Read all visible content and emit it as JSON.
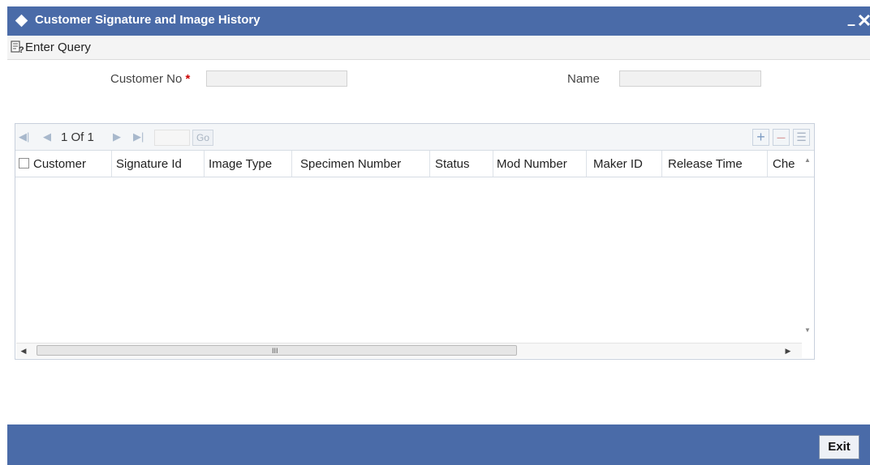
{
  "window": {
    "title": "Customer Signature and Image History",
    "minimize_glyph": "–",
    "close_glyph": "✕"
  },
  "toolbar": {
    "enter_query_label": "Enter Query",
    "enter_query_icon": "enter-query-icon"
  },
  "form": {
    "customer_no_label": "Customer No",
    "required_marker": "*",
    "customer_no_value": "",
    "name_label": "Name",
    "name_value": ""
  },
  "grid": {
    "pager": {
      "first_glyph": "◀|",
      "prev_glyph": "◀",
      "page_text": "1 Of 1",
      "next_glyph": "▶",
      "last_glyph": "▶|",
      "go_label": "Go"
    },
    "tools": {
      "add_glyph": "+",
      "delete_glyph": "–",
      "view_glyph": "☰"
    },
    "columns": [
      "Customer",
      "Signature Id",
      "Image Type",
      "Specimen Number",
      "Status",
      "Mod Number",
      "Maker ID",
      "Release Time",
      "Che"
    ],
    "rows": [],
    "scroll_grip": "III"
  },
  "footer": {
    "exit_label": "Exit"
  },
  "colors": {
    "header_bar": "#4a6ba8",
    "required": "#cc0000"
  }
}
